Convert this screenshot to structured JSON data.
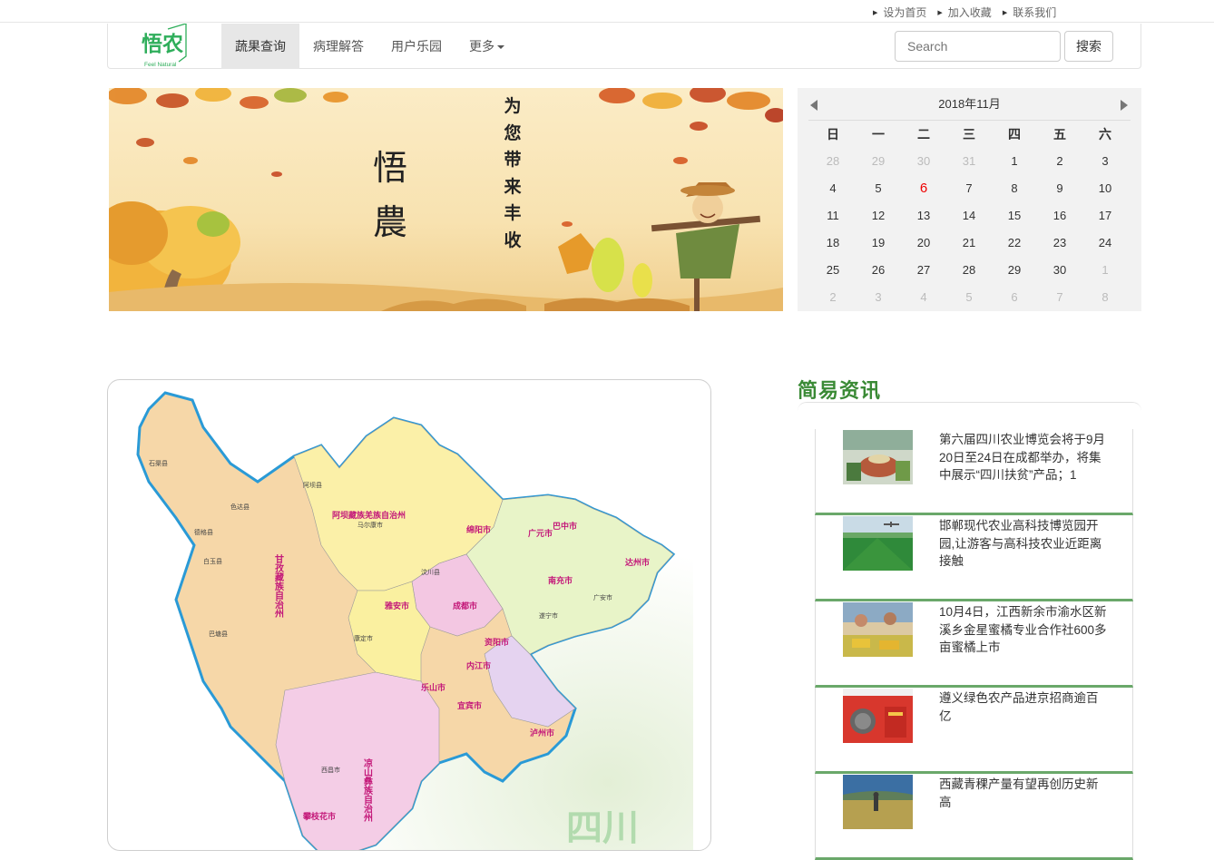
{
  "toplinks": [
    "设为首页",
    "加入收藏",
    "联系我们"
  ],
  "logo": {
    "text": "悟农",
    "subtext": "Feel Natural"
  },
  "nav": {
    "items": [
      "蔬果查询",
      "病理解答",
      "用户乐园",
      "更多"
    ],
    "active_index": 0
  },
  "search": {
    "placeholder": "Search",
    "button": "搜索"
  },
  "banner": {
    "vertical_text": "为您带来丰收",
    "logo_text": "悟農"
  },
  "calendar": {
    "title": "2018年11月",
    "weekdays": [
      "日",
      "一",
      "二",
      "三",
      "四",
      "五",
      "六"
    ],
    "days": [
      "28",
      "29",
      "30",
      "31",
      "1",
      "2",
      "3",
      "4",
      "5",
      "6",
      "7",
      "8",
      "9",
      "10",
      "11",
      "12",
      "13",
      "14",
      "15",
      "16",
      "17",
      "18",
      "19",
      "20",
      "21",
      "22",
      "23",
      "24",
      "25",
      "26",
      "27",
      "28",
      "29",
      "30",
      "1",
      "2",
      "3",
      "4",
      "5",
      "6",
      "7",
      "8"
    ],
    "today": "6"
  },
  "map": {
    "region_label": "四川"
  },
  "news": {
    "title": "简易资讯",
    "items": [
      {
        "text": "第六届四川农业博览会将于9月20日至24日在成都举办，将集中展示“四川扶贫”产品；1",
        "thumb": "greenhouse-expo"
      },
      {
        "text": "邯郸现代农业高科技博览园开园,让游客与高科技农业近距离接触",
        "thumb": "green-field-drone"
      },
      {
        "text": "10月4日，江西新余市渝水区新溪乡金星蜜橘专业合作社600多亩蜜橘上市",
        "thumb": "orange-harvest"
      },
      {
        "text": "遵义绿色农产品进京招商逾百亿",
        "thumb": "red-exhibition"
      },
      {
        "text": "西藏青稞产量有望再创历史新高",
        "thumb": "barley-field"
      }
    ]
  },
  "colors": {
    "accent_green": "#3a8a35",
    "today_red": "#e00000",
    "nav_active_bg": "#e7e7e7"
  }
}
